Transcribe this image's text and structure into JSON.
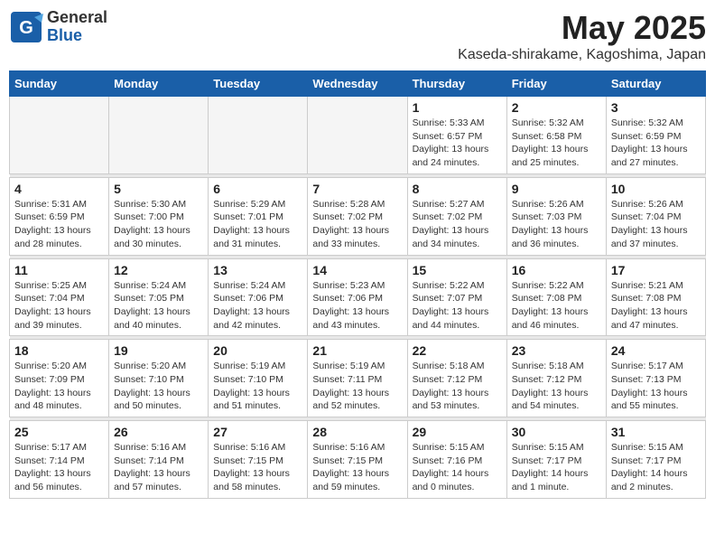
{
  "header": {
    "logo_general": "General",
    "logo_blue": "Blue",
    "month_year": "May 2025",
    "location": "Kaseda-shirakame, Kagoshima, Japan"
  },
  "weekdays": [
    "Sunday",
    "Monday",
    "Tuesday",
    "Wednesday",
    "Thursday",
    "Friday",
    "Saturday"
  ],
  "weeks": [
    [
      {
        "day": "",
        "empty": true
      },
      {
        "day": "",
        "empty": true
      },
      {
        "day": "",
        "empty": true
      },
      {
        "day": "",
        "empty": true
      },
      {
        "day": "1",
        "sunrise": "5:33 AM",
        "sunset": "6:57 PM",
        "daylight": "13 hours and 24 minutes."
      },
      {
        "day": "2",
        "sunrise": "5:32 AM",
        "sunset": "6:58 PM",
        "daylight": "13 hours and 25 minutes."
      },
      {
        "day": "3",
        "sunrise": "5:32 AM",
        "sunset": "6:59 PM",
        "daylight": "13 hours and 27 minutes."
      }
    ],
    [
      {
        "day": "4",
        "sunrise": "5:31 AM",
        "sunset": "6:59 PM",
        "daylight": "13 hours and 28 minutes."
      },
      {
        "day": "5",
        "sunrise": "5:30 AM",
        "sunset": "7:00 PM",
        "daylight": "13 hours and 30 minutes."
      },
      {
        "day": "6",
        "sunrise": "5:29 AM",
        "sunset": "7:01 PM",
        "daylight": "13 hours and 31 minutes."
      },
      {
        "day": "7",
        "sunrise": "5:28 AM",
        "sunset": "7:02 PM",
        "daylight": "13 hours and 33 minutes."
      },
      {
        "day": "8",
        "sunrise": "5:27 AM",
        "sunset": "7:02 PM",
        "daylight": "13 hours and 34 minutes."
      },
      {
        "day": "9",
        "sunrise": "5:26 AM",
        "sunset": "7:03 PM",
        "daylight": "13 hours and 36 minutes."
      },
      {
        "day": "10",
        "sunrise": "5:26 AM",
        "sunset": "7:04 PM",
        "daylight": "13 hours and 37 minutes."
      }
    ],
    [
      {
        "day": "11",
        "sunrise": "5:25 AM",
        "sunset": "7:04 PM",
        "daylight": "13 hours and 39 minutes."
      },
      {
        "day": "12",
        "sunrise": "5:24 AM",
        "sunset": "7:05 PM",
        "daylight": "13 hours and 40 minutes."
      },
      {
        "day": "13",
        "sunrise": "5:24 AM",
        "sunset": "7:06 PM",
        "daylight": "13 hours and 42 minutes."
      },
      {
        "day": "14",
        "sunrise": "5:23 AM",
        "sunset": "7:06 PM",
        "daylight": "13 hours and 43 minutes."
      },
      {
        "day": "15",
        "sunrise": "5:22 AM",
        "sunset": "7:07 PM",
        "daylight": "13 hours and 44 minutes."
      },
      {
        "day": "16",
        "sunrise": "5:22 AM",
        "sunset": "7:08 PM",
        "daylight": "13 hours and 46 minutes."
      },
      {
        "day": "17",
        "sunrise": "5:21 AM",
        "sunset": "7:08 PM",
        "daylight": "13 hours and 47 minutes."
      }
    ],
    [
      {
        "day": "18",
        "sunrise": "5:20 AM",
        "sunset": "7:09 PM",
        "daylight": "13 hours and 48 minutes."
      },
      {
        "day": "19",
        "sunrise": "5:20 AM",
        "sunset": "7:10 PM",
        "daylight": "13 hours and 50 minutes."
      },
      {
        "day": "20",
        "sunrise": "5:19 AM",
        "sunset": "7:10 PM",
        "daylight": "13 hours and 51 minutes."
      },
      {
        "day": "21",
        "sunrise": "5:19 AM",
        "sunset": "7:11 PM",
        "daylight": "13 hours and 52 minutes."
      },
      {
        "day": "22",
        "sunrise": "5:18 AM",
        "sunset": "7:12 PM",
        "daylight": "13 hours and 53 minutes."
      },
      {
        "day": "23",
        "sunrise": "5:18 AM",
        "sunset": "7:12 PM",
        "daylight": "13 hours and 54 minutes."
      },
      {
        "day": "24",
        "sunrise": "5:17 AM",
        "sunset": "7:13 PM",
        "daylight": "13 hours and 55 minutes."
      }
    ],
    [
      {
        "day": "25",
        "sunrise": "5:17 AM",
        "sunset": "7:14 PM",
        "daylight": "13 hours and 56 minutes."
      },
      {
        "day": "26",
        "sunrise": "5:16 AM",
        "sunset": "7:14 PM",
        "daylight": "13 hours and 57 minutes."
      },
      {
        "day": "27",
        "sunrise": "5:16 AM",
        "sunset": "7:15 PM",
        "daylight": "13 hours and 58 minutes."
      },
      {
        "day": "28",
        "sunrise": "5:16 AM",
        "sunset": "7:15 PM",
        "daylight": "13 hours and 59 minutes."
      },
      {
        "day": "29",
        "sunrise": "5:15 AM",
        "sunset": "7:16 PM",
        "daylight": "14 hours and 0 minutes."
      },
      {
        "day": "30",
        "sunrise": "5:15 AM",
        "sunset": "7:17 PM",
        "daylight": "14 hours and 1 minute."
      },
      {
        "day": "31",
        "sunrise": "5:15 AM",
        "sunset": "7:17 PM",
        "daylight": "14 hours and 2 minutes."
      }
    ]
  ]
}
